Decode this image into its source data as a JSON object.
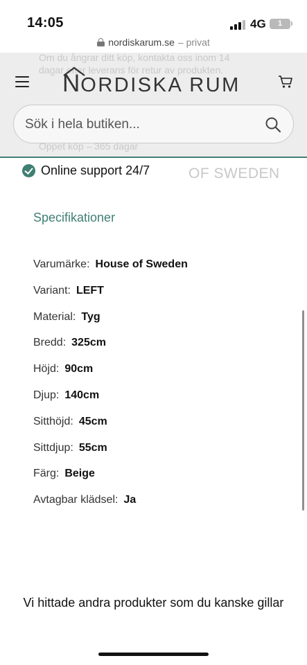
{
  "status_bar": {
    "time": "14:05",
    "network": "4G",
    "battery": "1"
  },
  "browser": {
    "domain": "nordiskarum.se",
    "mode": "– privat"
  },
  "header": {
    "logo_n": "N",
    "logo_rest": "ORDISKA RUM",
    "search_placeholder": "Sök i hela butiken...",
    "ghost_lines": [
      "Om du ångrar ditt köp, kontakta oss inom 14",
      "dagar efter leverans för retur av produkten.",
      "Öppet köp – 365 dagar"
    ]
  },
  "support": {
    "text": "Online support 24/7"
  },
  "brand_logo": {
    "text": "OF SWEDEN"
  },
  "specs": {
    "title": "Specifikationer",
    "rows": [
      {
        "label": "Varumärke:",
        "value": "House of Sweden"
      },
      {
        "label": "Variant:",
        "value": "LEFT"
      },
      {
        "label": "Material:",
        "value": "Tyg"
      },
      {
        "label": "Bredd:",
        "value": "325cm"
      },
      {
        "label": "Höjd:",
        "value": "90cm"
      },
      {
        "label": "Djup:",
        "value": "140cm"
      },
      {
        "label": "Sitthöjd:",
        "value": "45cm"
      },
      {
        "label": "Sittdjup:",
        "value": "55cm"
      },
      {
        "label": "Färg:",
        "value": "Beige"
      },
      {
        "label": "Avtagbar klädsel:",
        "value": "Ja"
      }
    ]
  },
  "related": {
    "title": "Vi hittade andra produkter som du kanske gillar"
  },
  "colors": {
    "accent": "#3f7f74",
    "header_bg": "#ececec"
  },
  "icons": [
    "lock-icon",
    "hamburger-icon",
    "cart-icon",
    "search-icon",
    "check-icon"
  ]
}
